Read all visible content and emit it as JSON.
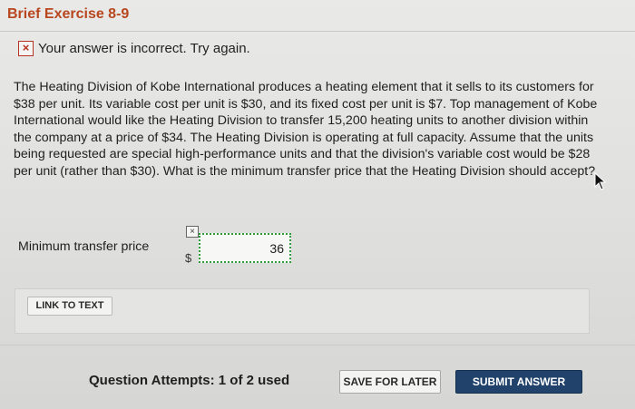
{
  "header": {
    "title": "Brief Exercise 8-9"
  },
  "feedback": {
    "icon": "incorrect-x-icon",
    "mark": "×",
    "message": "Your answer is incorrect.  Try again."
  },
  "question": {
    "text": "The Heating Division of Kobe International produces a heating element that it sells to its customers for $38 per unit. Its variable cost per unit is $30, and its fixed cost per unit is $7. Top management of Kobe International would like the Heating Division to transfer 15,200 heating units to another division within the company at a price of $34. The Heating Division is operating at full capacity. Assume that the units being requested are special high-performance units and that the division's variable cost would be $28 per unit (rather than $30). What is the minimum transfer price that the Heating Division should accept?"
  },
  "answer": {
    "label": "Minimum transfer price",
    "currency": "$",
    "status_mark": "×",
    "value": "36"
  },
  "links": {
    "link_to_text": "LINK TO TEXT"
  },
  "footer": {
    "attempts": "Question Attempts: 1 of 2 used",
    "save_label": "SAVE FOR LATER",
    "submit_label": "SUBMIT ANSWER"
  },
  "colors": {
    "title": "#b8461f",
    "error": "#b83224",
    "input_border": "#2f9b3a",
    "submit_bg": "#21426b"
  }
}
